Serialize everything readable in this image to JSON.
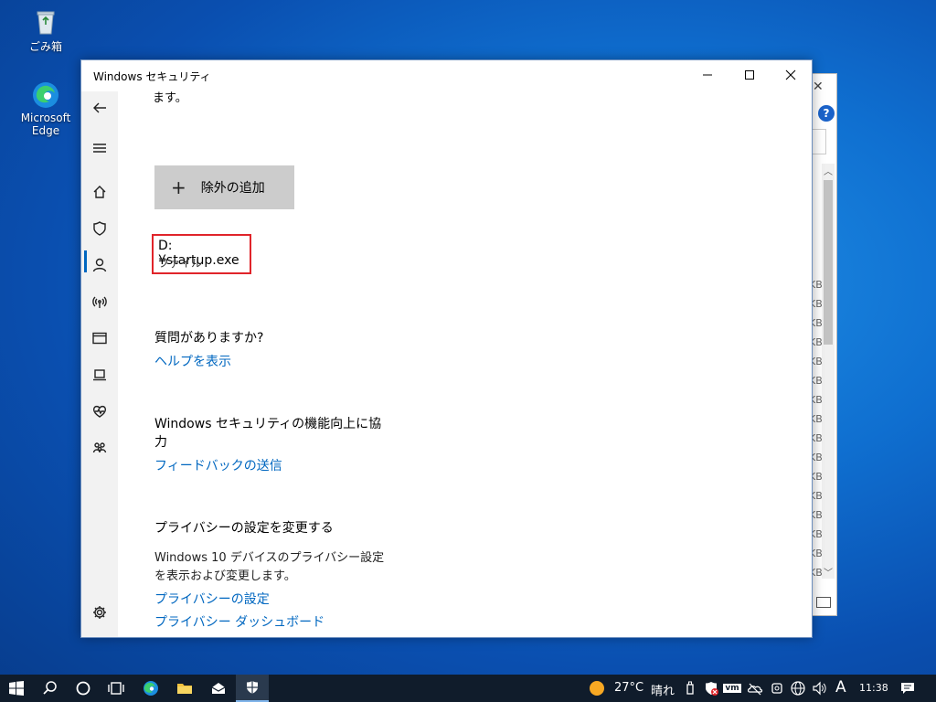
{
  "desktop": {
    "icons": [
      {
        "label": "ごみ箱",
        "icon": "recycle-bin-icon"
      },
      {
        "label": "Microsoft Edge",
        "icon": "edge-icon"
      }
    ]
  },
  "background_window": {
    "sizes": [
      "KB",
      "KB",
      "KB",
      "KB",
      "KB",
      "KB",
      "KB",
      "KB",
      "KB",
      "KB",
      "KB",
      "KB",
      "KB",
      "KB",
      "KB",
      "KB"
    ]
  },
  "window": {
    "title": "Windows セキュリティ",
    "buttons": {
      "minimize": "—",
      "maximize": "☐",
      "close": "✕"
    }
  },
  "content": {
    "top_fragment": "ます。",
    "add_exclusion": "除外の追加",
    "exclusion_path": "D:¥startup.exe",
    "exclusion_type": "ファイル",
    "question_heading": "質問がありますか?",
    "help_link": "ヘルプを表示",
    "improve_heading_1": "Windows セキュリティの機能向上に協",
    "improve_heading_2": "力",
    "feedback_link": "フィードバックの送信",
    "privacy_heading": "プライバシーの設定を変更する",
    "privacy_text_1": "Windows 10 デバイスのプライバシー設定",
    "privacy_text_2": "を表示および変更します。",
    "privacy_settings_link": "プライバシーの設定",
    "privacy_dashboard_link": "プライバシー ダッシュボード"
  },
  "taskbar": {
    "temperature": "27°C",
    "weather": "晴れ",
    "ime": "A",
    "time": "11:38",
    "vm_label": "vm"
  },
  "colors": {
    "accent": "#0067c0",
    "highlight": "#e0242a",
    "taskbar": "#101c2b"
  }
}
